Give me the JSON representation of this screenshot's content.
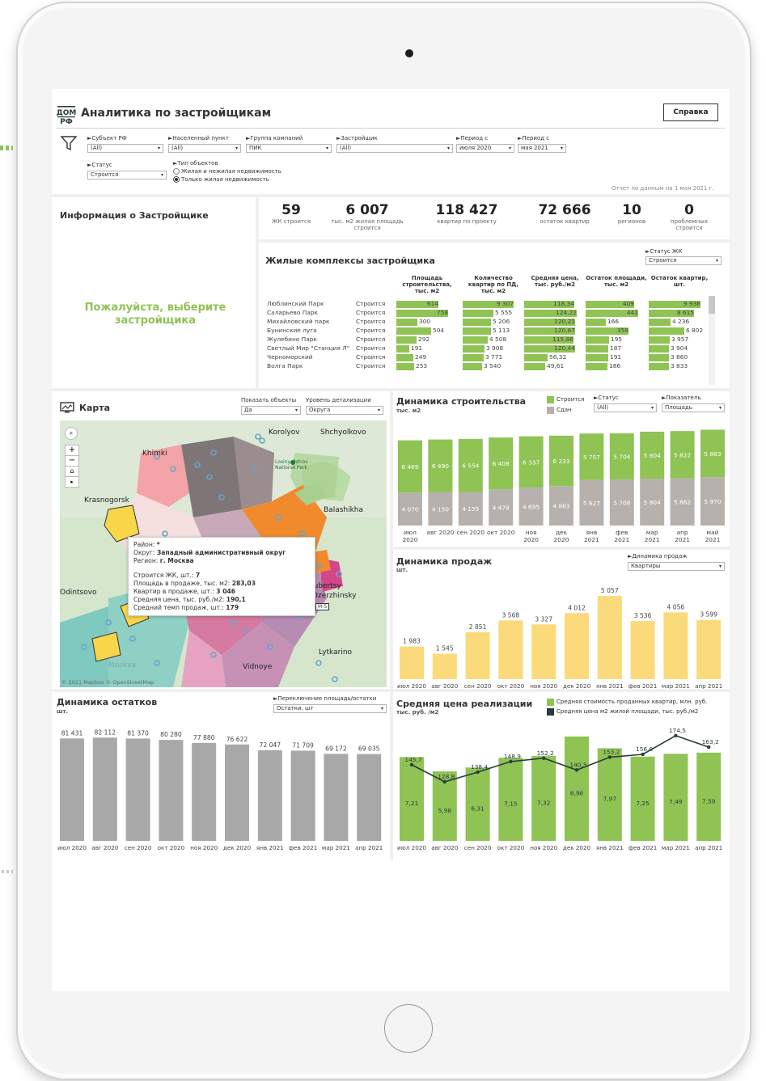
{
  "app": {
    "brand": "ДОМ РФ",
    "title": "Аналитика по застройщикам",
    "help_button": "Справка",
    "report_date": "Отчет по данным на 1 мая 2021 г."
  },
  "filters": {
    "subject": {
      "label": "►Субъект РФ",
      "value": "(All)"
    },
    "city": {
      "label": "►Населенный пункт",
      "value": "(All)"
    },
    "group": {
      "label": "►Группа компаний",
      "value": "ПИК"
    },
    "developer": {
      "label": "►Застройщик",
      "value": "(All)"
    },
    "period_from": {
      "label": "►Период с",
      "value": "июля 2020"
    },
    "period_to": {
      "label": "►Период с",
      "value": "мая 2021"
    },
    "status": {
      "label": "►Статус",
      "value": "Строится"
    },
    "object_type": {
      "label": "►Тип объектов",
      "options": [
        "Жилая и нежилая недвижимость",
        "Только жилая недвижимость"
      ],
      "selected": 1
    }
  },
  "info": {
    "title": "Информация о Застройщике",
    "prompt": "Пожалуйста, выберите застройщика"
  },
  "kpis": [
    {
      "value": "59",
      "label": "ЖК строится"
    },
    {
      "value": "6 007",
      "label": "тыс. м2 жилая площадь строится"
    },
    {
      "value": "118 427",
      "label": "квартир по проекту"
    },
    {
      "value": "72 666",
      "label": "остаток квартир"
    },
    {
      "value": "10",
      "label": "регионов"
    },
    {
      "value": "0",
      "label": "проблемных строится"
    }
  ],
  "complexes": {
    "title": "Жилые комплексы застройщика",
    "status_filter": {
      "label": "►Статус ЖК",
      "value": "Строится"
    },
    "columns": [
      "Площадь строительства, тыс. м2",
      "Количество квартир по ПД, тыс. м2",
      "Средняя цена, тыс. руб./м2",
      "Остаток площади, тыс. м2",
      "Остаток квартир, шт."
    ],
    "rows": [
      {
        "name": "Люблинский Парк",
        "status": "Строится",
        "area": "614",
        "flats": "9 307",
        "price": "118,34",
        "rest_area": "409",
        "rest_flats": "9 938",
        "v": [
          614,
          9307,
          118.34,
          409,
          9938
        ]
      },
      {
        "name": "Саларьево Парк",
        "status": "Строится",
        "area": "758",
        "flats": "5 555",
        "price": "124,22",
        "rest_area": "441",
        "rest_flats": "8 615",
        "v": [
          758,
          5555,
          124.22,
          441,
          8615
        ]
      },
      {
        "name": "Михайловский парк",
        "status": "Строится",
        "area": "300",
        "flats": "5 206",
        "price": "120,21",
        "rest_area": "166",
        "rest_flats": "4 236",
        "v": [
          300,
          5206,
          120.21,
          166,
          4236
        ]
      },
      {
        "name": "Бунинские луга",
        "status": "Строится",
        "area": "504",
        "flats": "5 113",
        "price": "120,67",
        "rest_area": "359",
        "rest_flats": "6 802",
        "v": [
          504,
          5113,
          120.67,
          359,
          6802
        ]
      },
      {
        "name": "Жулебино Парк",
        "status": "Строится",
        "area": "292",
        "flats": "4 508",
        "price": "115,86",
        "rest_area": "195",
        "rest_flats": "3 957",
        "v": [
          292,
          4508,
          115.86,
          195,
          3957
        ]
      },
      {
        "name": "Светлый Мир \"Станция Л\"",
        "status": "Строится",
        "area": "191",
        "flats": "3 908",
        "price": "120,44",
        "rest_area": "187",
        "rest_flats": "3 904",
        "v": [
          191,
          3908,
          120.44,
          187,
          3904
        ]
      },
      {
        "name": "Черноморский",
        "status": "Строится",
        "area": "249",
        "flats": "3 771",
        "price": "56,32",
        "rest_area": "191",
        "rest_flats": "3 860",
        "v": [
          249,
          3771,
          56.32,
          191,
          3860
        ]
      },
      {
        "name": "Волга Парк",
        "status": "Строится",
        "area": "253",
        "flats": "3 540",
        "price": "49,61",
        "rest_area": "186",
        "rest_flats": "3 833",
        "v": [
          253,
          3540,
          49.61,
          186,
          3833
        ]
      }
    ]
  },
  "map": {
    "title": "Карта",
    "show_objects": {
      "label": "Показать объекты",
      "value": "Да"
    },
    "detail_level": {
      "label": "Уровень детализации",
      "value": "Округа"
    },
    "place_labels": [
      "Korolyov",
      "Shchyolkovo",
      "Khimki",
      "Losiny Ostrov National Park",
      "Krasnogorsk",
      "Balashikha",
      "Odintsovo",
      "Lyubertsy",
      "Dzerzhinsky",
      "Vidnoye",
      "Lytkarino",
      "Moskva",
      "M-5"
    ],
    "attribution": "© 2021 Mapbox © OpenStreetMap",
    "tooltip": {
      "district_label": "Район:",
      "district_value": "*",
      "okrug_label": "Округ:",
      "okrug_value": "Западный административный округ",
      "region_label": "Регион:",
      "region_value": "г. Москва",
      "lines": [
        {
          "label": "Строится ЖК, шт.:",
          "value": "7"
        },
        {
          "label": "Площадь в продаже, тыс. м2:",
          "value": "283,03"
        },
        {
          "label": "Квартир в продаже, шт.:",
          "value": "3 046"
        },
        {
          "label": "Средняя цена, тыс. руб./м2:",
          "value": "190,1"
        },
        {
          "label": "Средний темп продаж, шт.:",
          "value": "179"
        }
      ]
    }
  },
  "construction": {
    "title": "Динамика строительства",
    "subtitle": "тыс. м2",
    "legend": [
      "Строится",
      "Сдан"
    ],
    "status_filter": {
      "label": "►Статус",
      "value": "(All)"
    },
    "indicator_filter": {
      "label": "►Показатель",
      "value": "Площадь"
    }
  },
  "sales": {
    "title": "Динамика продаж",
    "subtitle": "шт.",
    "filter": {
      "label": "►Динамика продаж",
      "value": "Квартиры"
    }
  },
  "remains": {
    "title": "Динамика остатков",
    "subtitle": "шт.",
    "filter": {
      "label": "►Переключение площадь/остатки",
      "value": "Остатки, шт"
    }
  },
  "avg_price": {
    "title": "Средняя цена реализации",
    "subtitle": "тыс. руб. /м2",
    "legend": [
      "Средняя стоимость проданных квартир, млн. руб.",
      "Средняя цена м2 жилой площади, тыс. руб./м2"
    ]
  },
  "chart_data": [
    {
      "type": "bar",
      "title": "Динамика строительства",
      "ylabel": "тыс. м2",
      "categories": [
        "июл 2020",
        "авг 2020",
        "сен 2020",
        "окт 2020",
        "ноя 2020",
        "дек 2020",
        "янв 2021",
        "фев 2021",
        "мар 2021",
        "апр 2021",
        "май 2021"
      ],
      "series": [
        {
          "name": "Сдан",
          "values": [
            4070,
            4150,
            4155,
            4478,
            4695,
            4883,
            5627,
            5708,
            5804,
            5862,
            5970
          ]
        },
        {
          "name": "Строится",
          "values": [
            6469,
            6490,
            6554,
            6408,
            6337,
            6233,
            5757,
            5704,
            5804,
            5822,
            5883
          ]
        }
      ],
      "stacked": true
    },
    {
      "type": "bar",
      "title": "Динамика продаж",
      "ylabel": "шт.",
      "categories": [
        "июл 2020",
        "авг 2020",
        "сен 2020",
        "окт 2020",
        "ноя 2020",
        "дек 2020",
        "янв 2021",
        "фев 2021",
        "мар 2021",
        "апр 2021"
      ],
      "values": [
        1983,
        1545,
        2851,
        3568,
        3327,
        4012,
        5057,
        3536,
        4056,
        3599
      ],
      "labels": [
        "1 983",
        "1 545",
        "2 851",
        "3 568",
        "3 327",
        "4 012",
        "5 057",
        "3 536",
        "4 056",
        "3 599"
      ]
    },
    {
      "type": "bar",
      "title": "Динамика остатков",
      "ylabel": "шт.",
      "categories": [
        "июл 2020",
        "авг 2020",
        "сен 2020",
        "окт 2020",
        "ноя 2020",
        "дек 2020",
        "янв 2021",
        "фев 2021",
        "мар 2021",
        "апр 2021"
      ],
      "values": [
        81431,
        82112,
        81370,
        80280,
        77880,
        76622,
        72047,
        71709,
        69172,
        69035
      ],
      "labels": [
        "81 431",
        "82 112",
        "81 370",
        "80 280",
        "77 880",
        "76 622",
        "72 047",
        "71 709",
        "69 172",
        "69 035"
      ]
    },
    {
      "type": "bar",
      "title": "Средняя цена реализации",
      "ylabel": "тыс. руб. /м2",
      "categories": [
        "июл 2020",
        "авг 2020",
        "сен 2020",
        "окт 2020",
        "ноя 2020",
        "дек 2020",
        "янв 2021",
        "фев 2021",
        "мар 2021",
        "апр 2021"
      ],
      "series": [
        {
          "name": "Средняя стоимость проданных квартир, млн. руб.",
          "values": [
            7.21,
            5.98,
            6.31,
            7.15,
            7.32,
            8.98,
            7.97,
            7.25,
            7.49,
            7.59
          ],
          "labels": [
            "7,21",
            "5,98",
            "6,31",
            "7,15",
            "7,32",
            "8,98",
            "7,97",
            "7,25",
            "7,49",
            "7,59"
          ]
        },
        {
          "name": "Средняя цена м2 жилой площади, тыс. руб./м2",
          "type": "line",
          "values": [
            145.7,
            128.8,
            138.4,
            148.9,
            152.2,
            140.5,
            153.2,
            156.0,
            174.5,
            163.2
          ],
          "labels": [
            "145,7",
            "128,8",
            "138,4",
            "148,9",
            "152,2",
            "140,5",
            "153,2",
            "156,0",
            "174,5",
            "163,2"
          ]
        }
      ]
    }
  ],
  "axis_labels": {
    "construction_x": [
      [
        "июл",
        "2020"
      ],
      [
        "авг 2020",
        ""
      ],
      [
        "сен 2020",
        ""
      ],
      [
        "окт 2020",
        ""
      ],
      [
        "ноя",
        "2020"
      ],
      [
        "дек",
        "2020"
      ],
      [
        "янв",
        "2021"
      ],
      [
        "фев",
        "2021"
      ],
      [
        "мар",
        "2021"
      ],
      [
        "апр",
        "2021"
      ],
      [
        "май",
        "2021"
      ]
    ]
  },
  "colors": {
    "green": "#8fc354",
    "gray": "#b7b1ad",
    "gold": "#fada7a",
    "dark": "#2b3a3f",
    "bar_gray": "#a8a8a8"
  }
}
